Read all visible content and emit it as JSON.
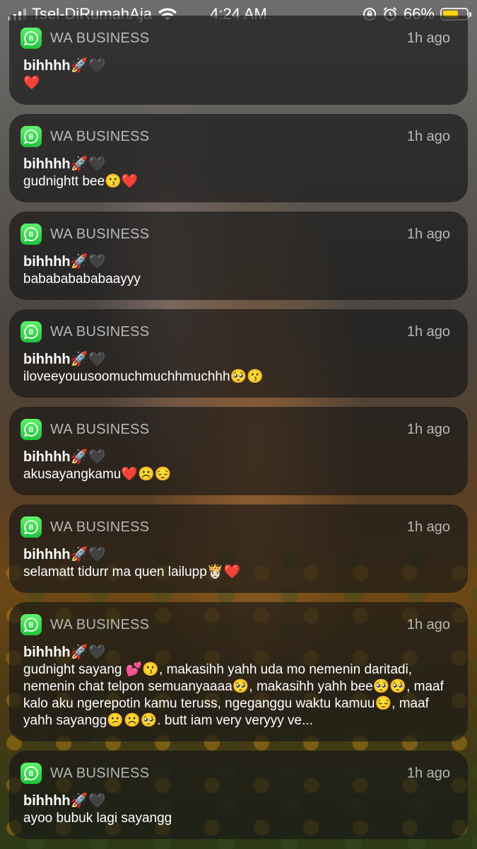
{
  "status_bar": {
    "carrier": "Tsel-DiRumahAja",
    "time": "4:24 AM",
    "battery_percent": "66%",
    "battery_level": 0.66,
    "accent_battery": "#ffd60a",
    "icons": [
      "signal-icon",
      "wifi-icon",
      "orientation-lock-icon",
      "alarm-icon",
      "battery-icon"
    ]
  },
  "notifications": [
    {
      "app": "WA BUSINESS",
      "time": "1h ago",
      "title": "bihhhh🚀🖤",
      "body": "❤️"
    },
    {
      "app": "WA BUSINESS",
      "time": "1h ago",
      "title": "bihhhh🚀🖤",
      "body": "gudnightt bee😗❤️"
    },
    {
      "app": "WA BUSINESS",
      "time": "1h ago",
      "title": "bihhhh🚀🖤",
      "body": "babababababaayyy"
    },
    {
      "app": "WA BUSINESS",
      "time": "1h ago",
      "title": "bihhhh🚀🖤",
      "body": "iloveeyouusoomuchmuchhmuchhh🥺😗"
    },
    {
      "app": "WA BUSINESS",
      "time": "1h ago",
      "title": "bihhhh🚀🖤",
      "body": "akusayangkamu❤️☹️😔"
    },
    {
      "app": "WA BUSINESS",
      "time": "1h ago",
      "title": "bihhhh🚀🖤",
      "body": "selamatt tidurr ma quen lailupp👸🏻❤️"
    },
    {
      "app": "WA BUSINESS",
      "time": "1h ago",
      "title": "bihhhh🚀🖤",
      "body": "gudnight sayang 💕😗, makasihh yahh uda mo nemenin daritadi, nemenin chat telpon semuanyaaaa🥺, makasihh yahh bee🥺🥺, maaf kalo aku ngerepotin kamu teruss, ngeganggu waktu kamuu😔, maaf yahh sayangg😕☹️🥺. butt iam very veryyy ve..."
    },
    {
      "app": "WA BUSINESS",
      "time": "1h ago",
      "title": "bihhhh🚀🖤",
      "body": "ayoo bubuk lagi sayangg"
    }
  ],
  "colors": {
    "app_icon": "#25d366",
    "card_background": "rgba(24,24,24,0.68)"
  }
}
